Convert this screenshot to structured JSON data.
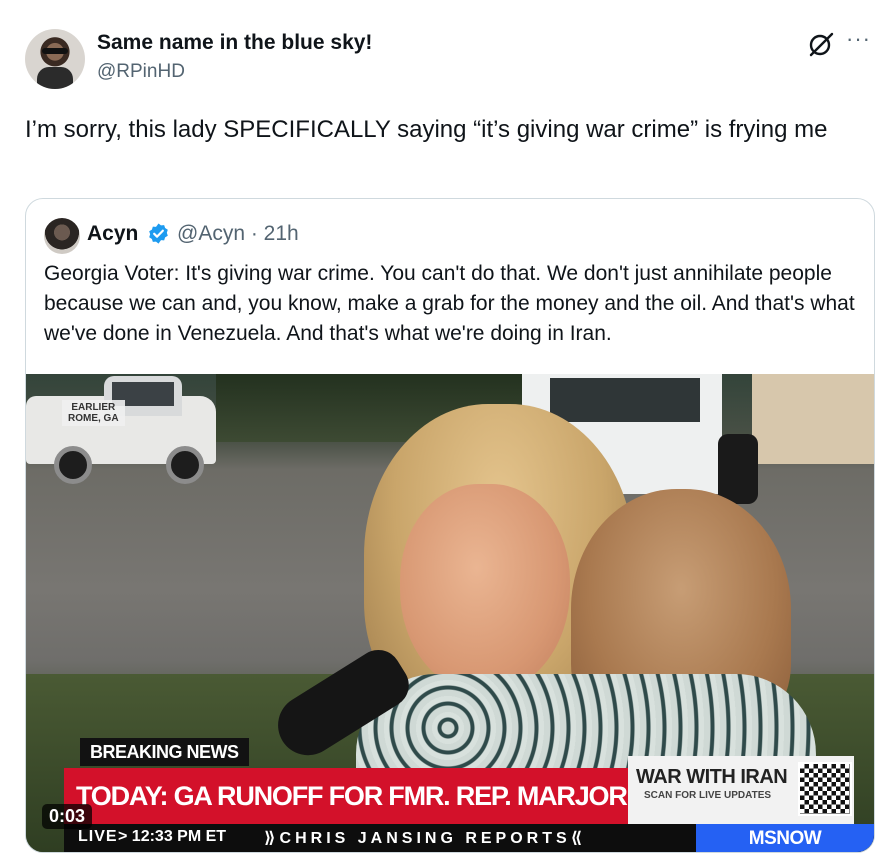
{
  "tweet": {
    "display_name": "Same name in the blue sky!",
    "handle": "@RPinHD",
    "text": "I’m sorry, this lady SPECIFICALLY saying “it’s giving war crime” is frying me",
    "icons": [
      "grok-icon",
      "more-icon"
    ],
    "more_glyph": "···"
  },
  "quote": {
    "display_name": "Acyn",
    "meta": "@Acyn · 21h",
    "text": "Georgia Voter: It's giving war crime. You can't do that. We don't just annihilate people because we can and, you know, make a grab for the money and the oil. And that's what we've done in Venezuela. And that's what we're doing in Iran.",
    "verified_color": "#1d9bf0"
  },
  "video": {
    "location_tag_line1": "EARLIER",
    "location_tag_line2": "ROME, GA",
    "breaking_label": "BREAKING NEWS",
    "headline": "TODAY: GA RUNOFF FOR FMR. REP. MARJORIE TAYLOR GREENE'S SEAT",
    "side_title": "WAR WITH IRAN",
    "side_sub": "SCAN FOR LIVE UPDATES",
    "live": "LIVE",
    "time": "> 12:33 PM ET",
    "show_name": "⟫CHRIS JANSING REPORTS⟪",
    "network": "MSNOW",
    "network_color": "#2561f3",
    "headline_color": "#d3112a",
    "timestamp": "0:03"
  }
}
